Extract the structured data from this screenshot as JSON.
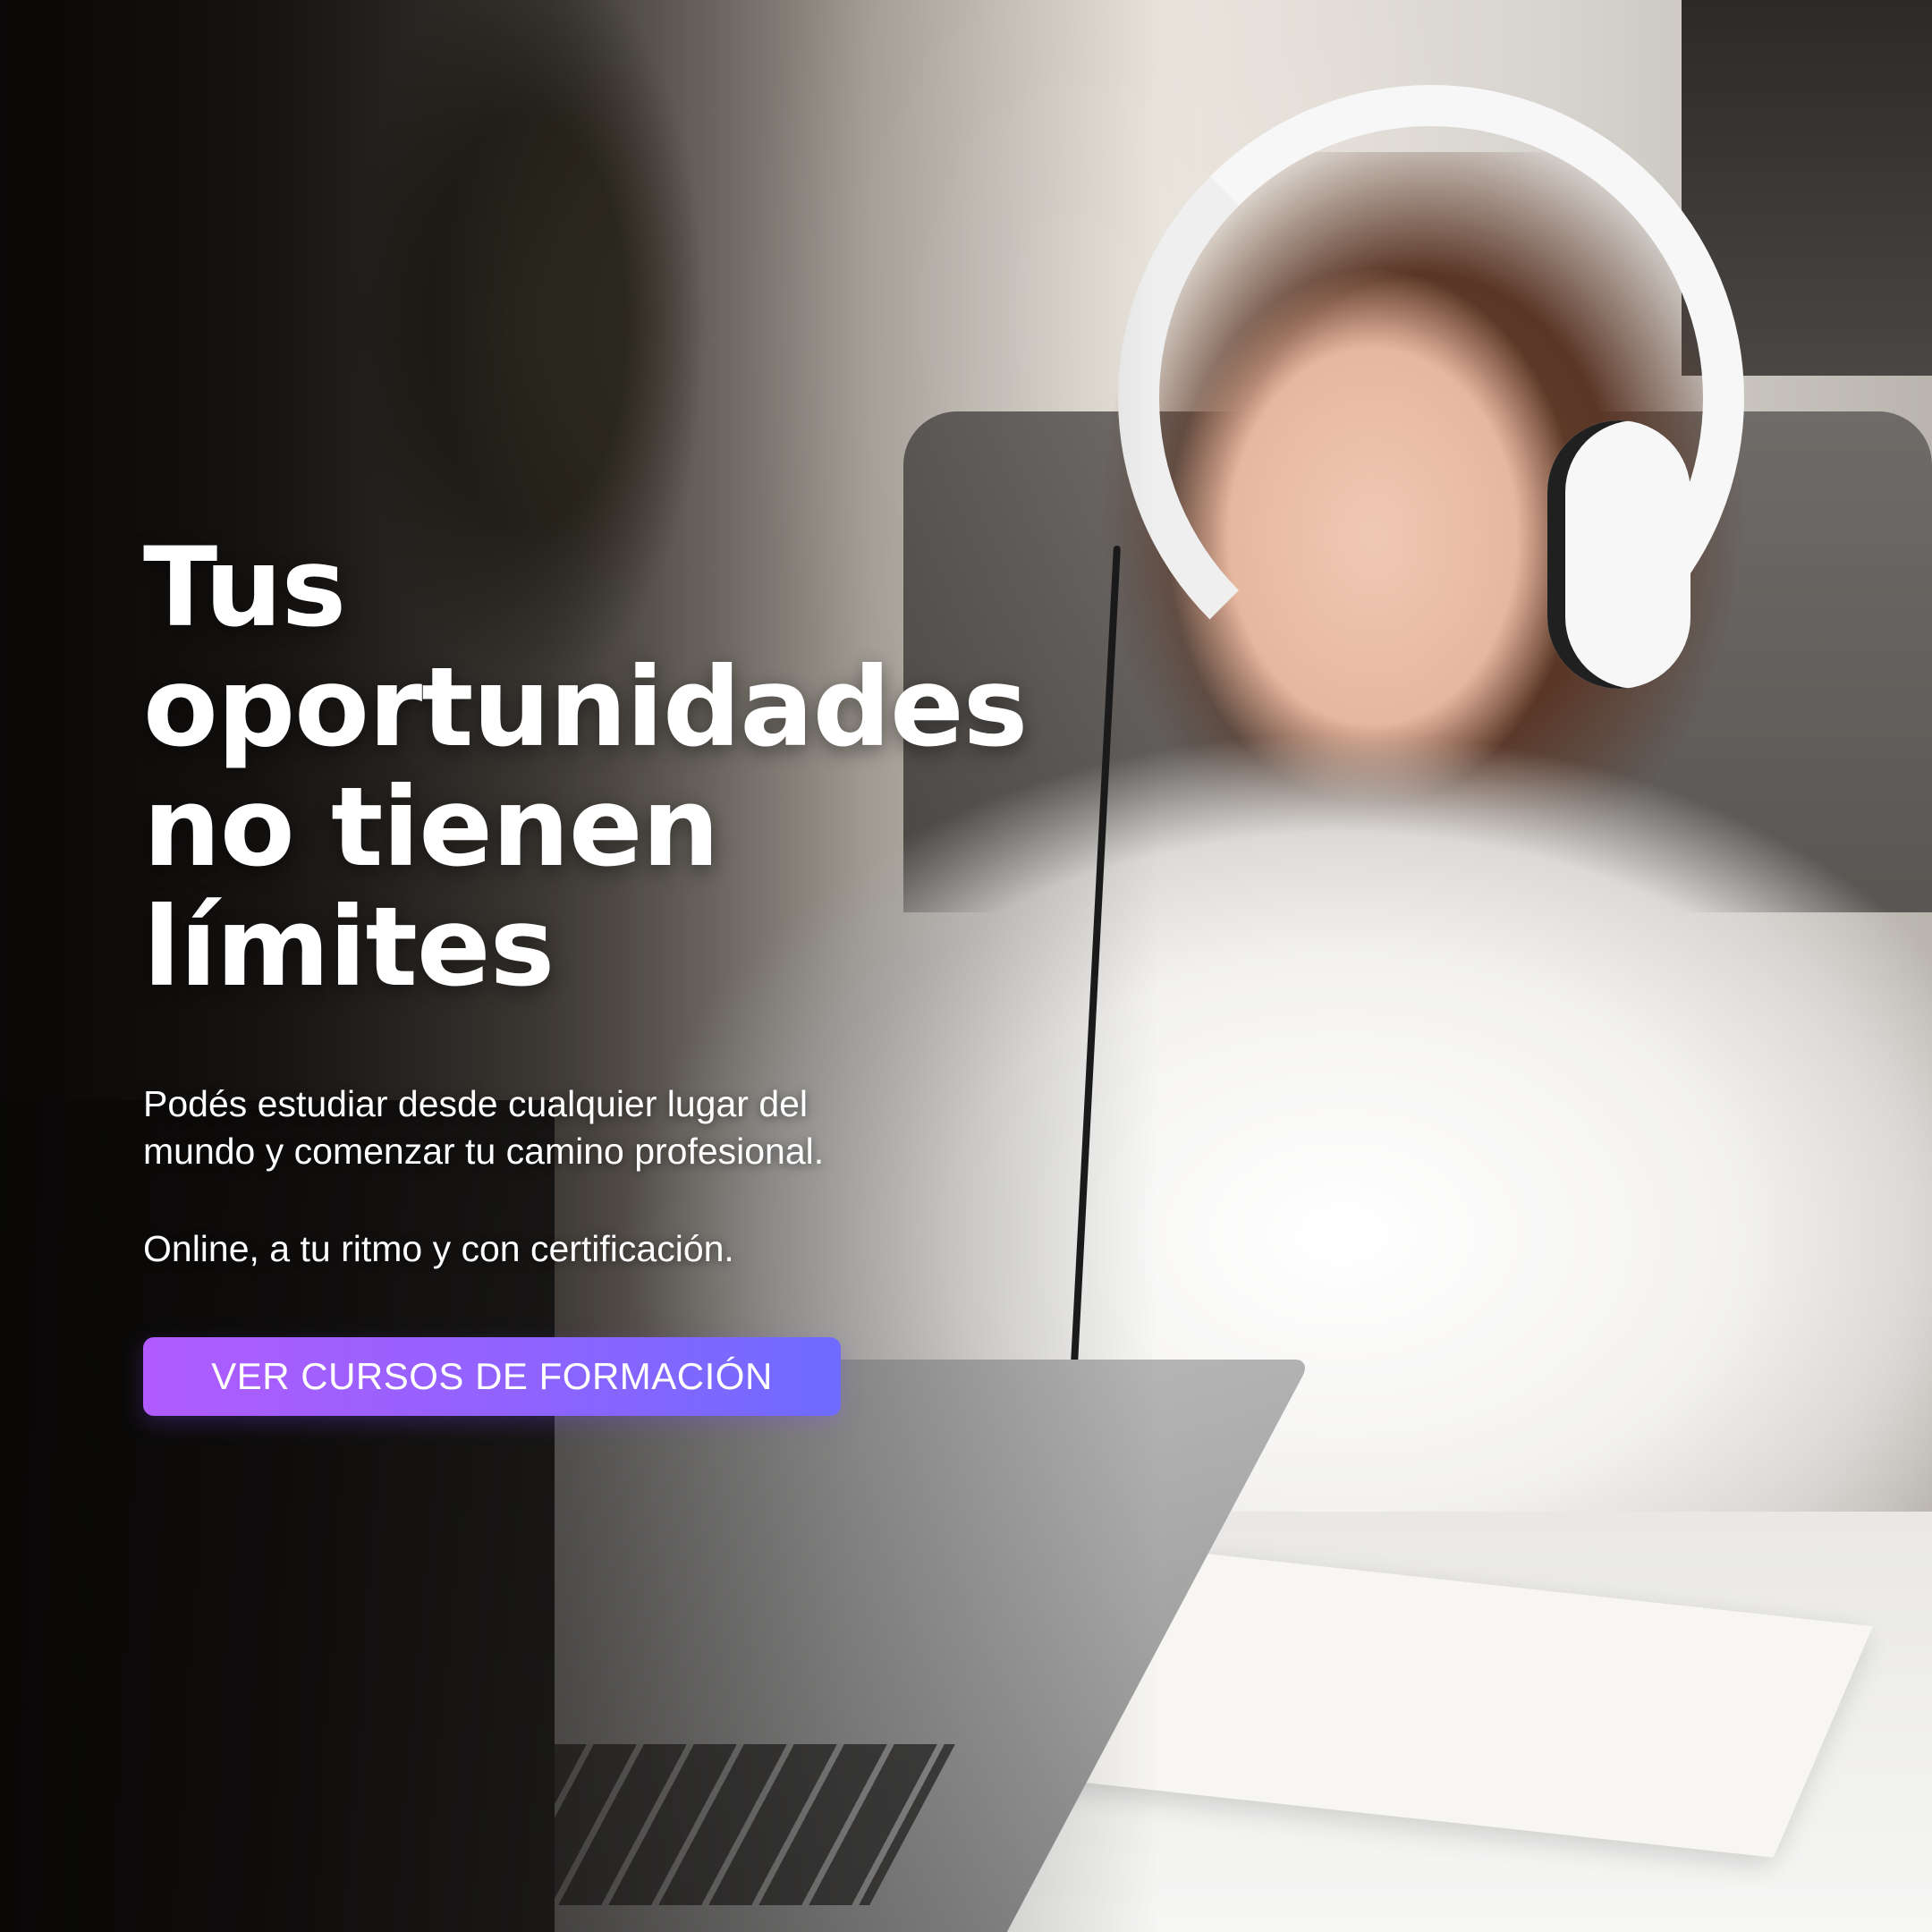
{
  "headline": {
    "line1": "Tus",
    "line2": "oportunidades",
    "line3": "no tienen",
    "line4": "límites"
  },
  "description": {
    "line1": "Podés estudiar desde cualquier lugar del",
    "line2": "mundo y comenzar tu camino profesional.",
    "line3": "Online, a tu ritmo y con certificación."
  },
  "cta": {
    "label": "VER CURSOS DE FORMACIÓN"
  },
  "colors": {
    "cta_gradient_start": "#b15bff",
    "cta_gradient_end": "#6f6bff",
    "text": "#ffffff"
  }
}
